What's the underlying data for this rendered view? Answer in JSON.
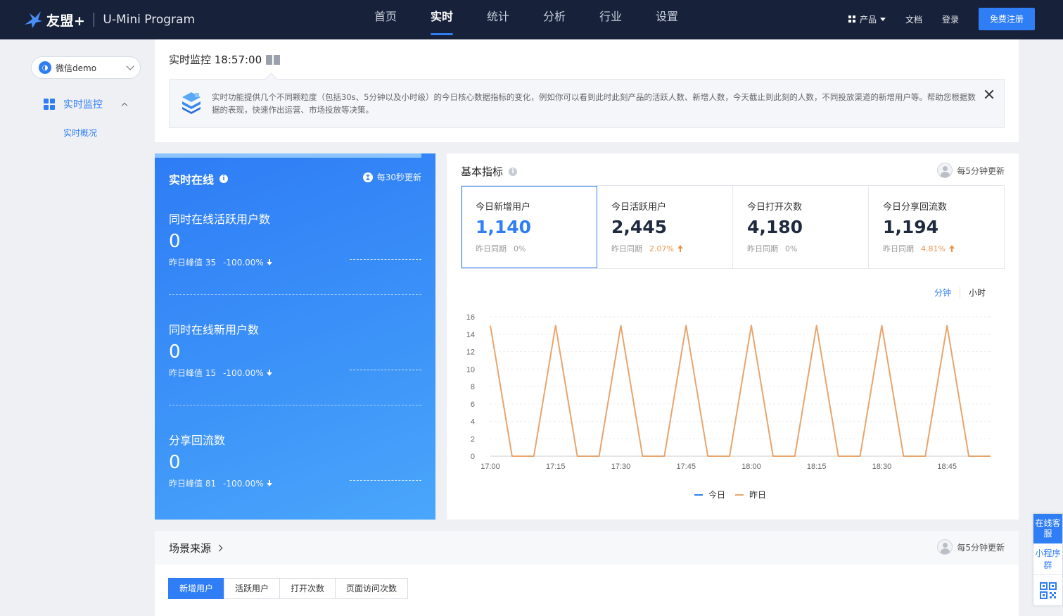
{
  "nav": {
    "brand": "友盟+",
    "product": "U-Mini Program",
    "links": [
      "首页",
      "实时",
      "统计",
      "分析",
      "行业",
      "设置"
    ],
    "active_link": "实时",
    "products_label": "产品",
    "docs_label": "文档",
    "login_label": "登录",
    "signup_label": "免费注册"
  },
  "sidebar": {
    "app_name": "微信demo",
    "section_label": "实时监控",
    "sub_item": "实时概况"
  },
  "header": {
    "title": "实时监控 18:57:00",
    "banner_text": "实时功能提供几个不同颗粒度（包括30s、5分钟以及小时级）的今日核心数据指标的变化，例如你可以看到此时此刻产品的活跃人数、新增人数，今天截止到此刻的人数，不同投放渠道的新增用户等。帮助您根据数据的表现，快速作出运营、市场投放等决策。"
  },
  "online": {
    "title": "实时在线",
    "refresh": "每30秒更新",
    "metrics": [
      {
        "label": "同时在线活跃用户数",
        "value": "0",
        "peak": "昨日峰值 35",
        "change": "-100.00%"
      },
      {
        "label": "同时在线新用户数",
        "value": "0",
        "peak": "昨日峰值 15",
        "change": "-100.00%"
      },
      {
        "label": "分享回流数",
        "value": "0",
        "peak": "昨日峰值 81",
        "change": "-100.00%"
      }
    ]
  },
  "basic": {
    "title": "基本指标",
    "update": "每5分钟更新",
    "kpis": [
      {
        "label": "今日新增用户",
        "value": "1,140",
        "compare": "昨日同期",
        "pct": "0%",
        "trend": "flat"
      },
      {
        "label": "今日活跃用户",
        "value": "2,445",
        "compare": "昨日同期",
        "pct": "2.07%",
        "trend": "up"
      },
      {
        "label": "今日打开次数",
        "value": "4,180",
        "compare": "昨日同期",
        "pct": "0%",
        "trend": "flat"
      },
      {
        "label": "今日分享回流数",
        "value": "1,194",
        "compare": "昨日同期",
        "pct": "4.81%",
        "trend": "up"
      }
    ],
    "granularity": [
      "分钟",
      "小时"
    ],
    "legend": [
      "今日",
      "昨日"
    ]
  },
  "chart_data": {
    "type": "line",
    "x": [
      "17:00",
      "17:05",
      "17:10",
      "17:15",
      "17:20",
      "17:25",
      "17:30",
      "17:35",
      "17:40",
      "17:45",
      "17:50",
      "17:55",
      "18:00",
      "18:05",
      "18:10",
      "18:15",
      "18:20",
      "18:25",
      "18:30",
      "18:35",
      "18:40",
      "18:45",
      "18:50",
      "18:55"
    ],
    "x_tick_labels": [
      "17:00",
      "17:15",
      "17:30",
      "17:45",
      "18:00",
      "18:15",
      "18:30",
      "18:45"
    ],
    "ylim": [
      0,
      16
    ],
    "y_ticks": [
      0,
      2,
      4,
      6,
      8,
      10,
      12,
      14,
      16
    ],
    "grid": "horizontal dashed",
    "legend_position": "bottom",
    "series": [
      {
        "name": "今日",
        "color": "#2f7ef5",
        "values": []
      },
      {
        "name": "昨日",
        "color": "#e9a46b",
        "values": [
          15,
          0,
          0,
          15,
          0,
          0,
          15,
          0,
          0,
          15,
          0,
          0,
          15,
          0,
          0,
          15,
          0,
          0,
          15,
          0,
          0,
          15,
          0,
          0
        ]
      }
    ]
  },
  "scene": {
    "title": "场景来源",
    "update": "每5分钟更新",
    "tabs": [
      "新增用户",
      "活跃用户",
      "打开次数",
      "页面访问次数"
    ]
  },
  "float": {
    "service": "在线客服",
    "group": "小程序群"
  },
  "colors": {
    "nav_bg": "#17213a",
    "accent": "#2f7ef5",
    "yesterday_line": "#e9a46b",
    "up_trend": "#e8964f"
  }
}
